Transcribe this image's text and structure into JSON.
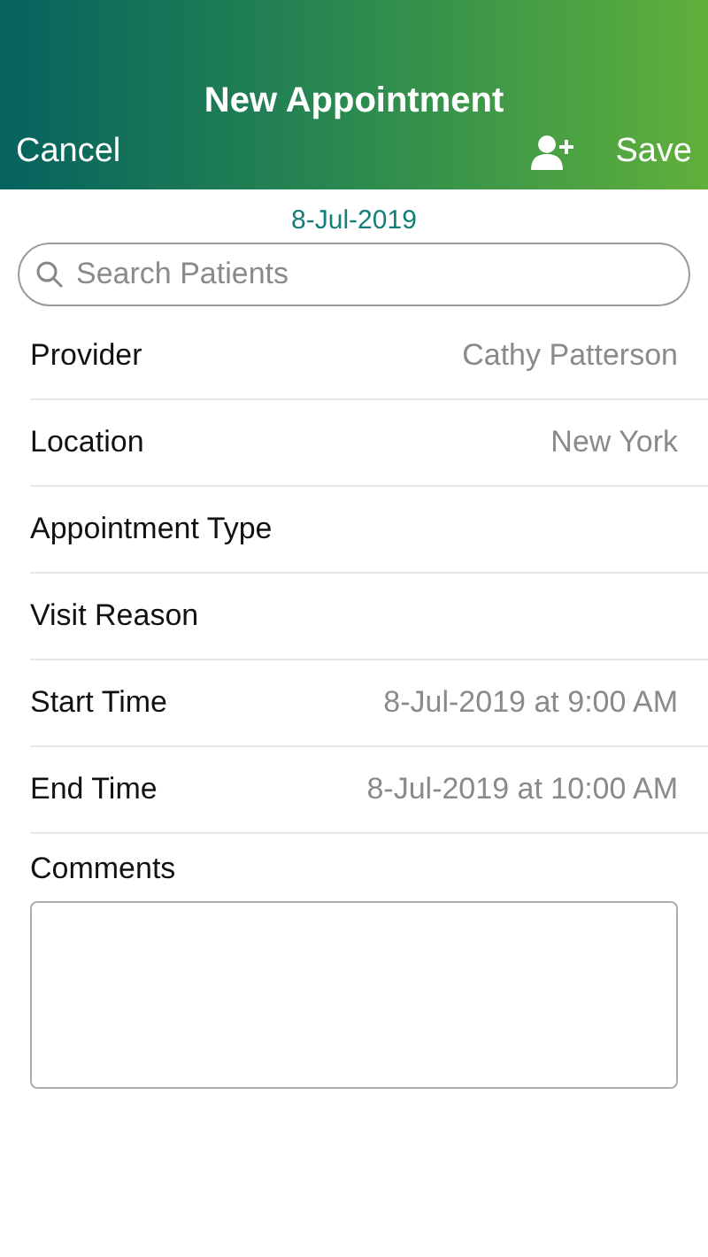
{
  "header": {
    "title": "New Appointment",
    "cancel": "Cancel",
    "save": "Save"
  },
  "date": "8-Jul-2019",
  "search": {
    "placeholder": "Search Patients"
  },
  "fields": [
    {
      "label": "Provider",
      "value": "Cathy Patterson"
    },
    {
      "label": "Location",
      "value": "New York"
    },
    {
      "label": "Appointment Type"
    },
    {
      "label": "Visit Reason"
    },
    {
      "label": "Start Time",
      "value": "8-Jul-2019 at 9:00 AM"
    },
    {
      "label": "End Time",
      "value": "8-Jul-2019 at 10:00 AM"
    }
  ],
  "comments": {
    "label": "Comments"
  }
}
